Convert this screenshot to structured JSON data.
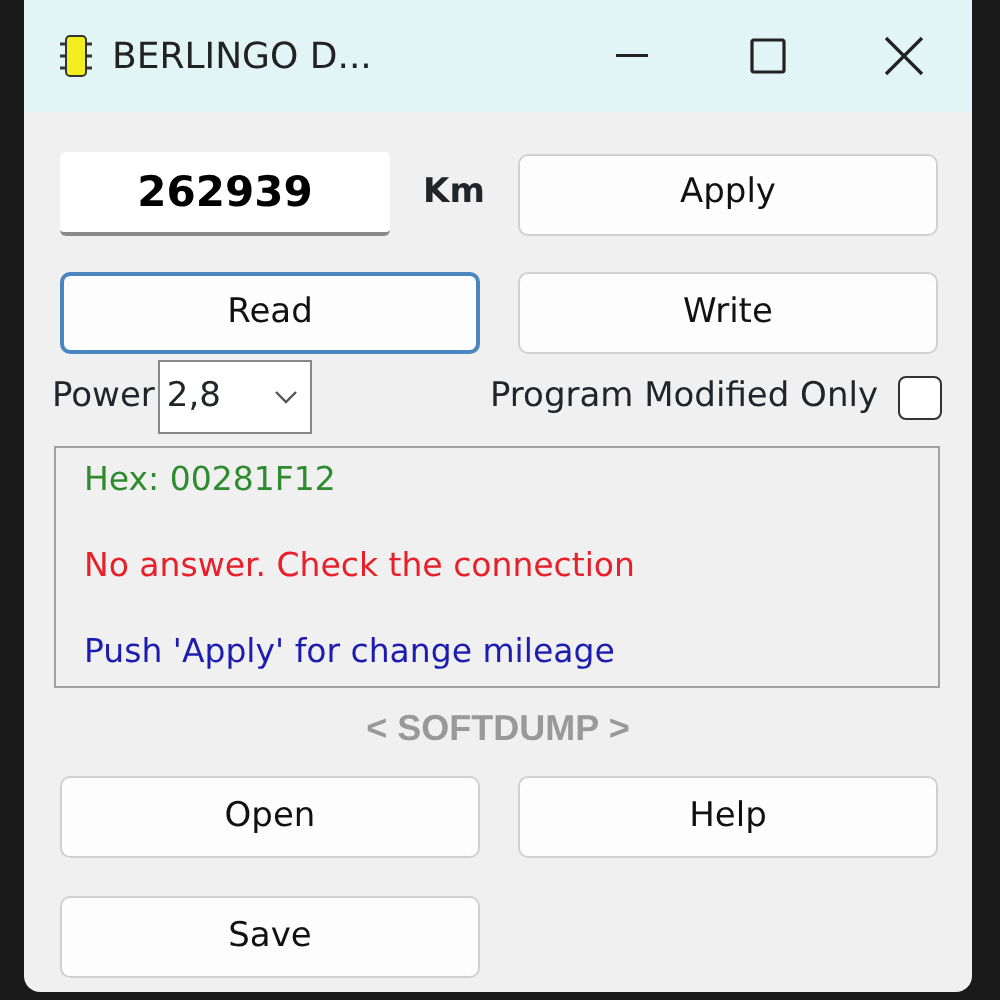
{
  "window": {
    "title": "BERLINGO D..."
  },
  "mileage": {
    "value": "262939",
    "unit": "Km"
  },
  "buttons_top": [
    {
      "label": "Apply",
      "focused": false
    },
    {
      "label": "Read",
      "focused": true
    },
    {
      "label": "Write",
      "focused": false
    }
  ],
  "power": {
    "label": "Power",
    "value": "2,8"
  },
  "program_modified_only": {
    "label": "Program Modified Only",
    "checked": false
  },
  "log": [
    {
      "text": "Hex: 00281F12",
      "color": "#2e8b2e"
    },
    {
      "text": "No answer. Check the connection",
      "color": "#e8202a"
    },
    {
      "text": "Push 'Apply' for change mileage",
      "color": "#1c1cb0"
    }
  ],
  "brand": "< SOFTDUMP >",
  "buttons_bottom": [
    {
      "label": "Open",
      "focused": false
    },
    {
      "label": "Help",
      "focused": false
    },
    {
      "label": "Save",
      "focused": false
    }
  ]
}
